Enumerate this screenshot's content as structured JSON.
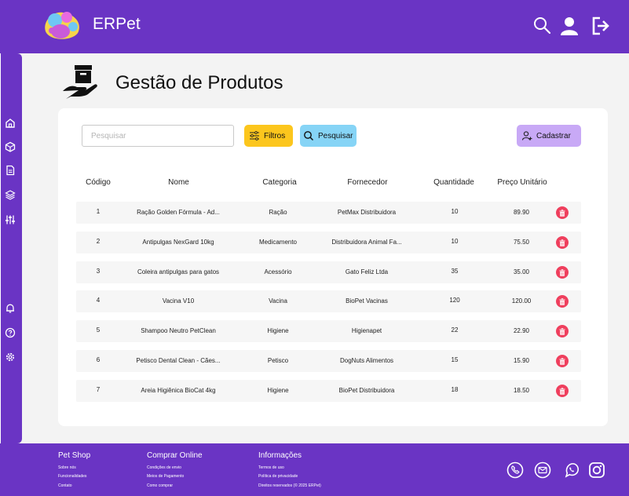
{
  "app": {
    "brand": "ERPet"
  },
  "page": {
    "title": "Gestão de Produtos"
  },
  "toolbar": {
    "search_placeholder": "Pesquisar",
    "filters_label": "Filtros",
    "search_label": "Pesquisar",
    "register_label": "Cadastrar"
  },
  "table": {
    "headers": {
      "code": "Código",
      "name": "Nome",
      "category": "Categoria",
      "supplier": "Fornecedor",
      "quantity": "Quantidade",
      "unit_price": "Preço Unitário"
    },
    "rows": [
      {
        "code": "1",
        "name": "Ração Golden Fórmula - Ad...",
        "category": "Ração",
        "supplier": "PetMax Distribuidora",
        "quantity": "10",
        "unit_price": "89.90"
      },
      {
        "code": "2",
        "name": "Antipulgas NexGard 10kg",
        "category": "Medicamento",
        "supplier": "Distribuidora Animal Fa...",
        "quantity": "10",
        "unit_price": "75.50"
      },
      {
        "code": "3",
        "name": "Coleira antipulgas para gatos",
        "category": "Acessório",
        "supplier": "Gato Feliz Ltda",
        "quantity": "35",
        "unit_price": "35.00"
      },
      {
        "code": "4",
        "name": "Vacina V10",
        "category": "Vacina",
        "supplier": "BioPet Vacinas",
        "quantity": "120",
        "unit_price": "120.00"
      },
      {
        "code": "5",
        "name": "Shampoo Neutro PetClean",
        "category": "Higiene",
        "supplier": "Higienapet",
        "quantity": "22",
        "unit_price": "22.90"
      },
      {
        "code": "6",
        "name": "Petisco Dental Clean - Cães...",
        "category": "Petisco",
        "supplier": "DogNuts Alimentos",
        "quantity": "15",
        "unit_price": "15.90"
      },
      {
        "code": "7",
        "name": "Areia Higiênica BioCat 4kg",
        "category": "Higiene",
        "supplier": "BioPet Distribuidora",
        "quantity": "18",
        "unit_price": "18.50"
      }
    ]
  },
  "footer": {
    "columns": [
      {
        "title": "Pet Shop",
        "links": [
          "Sobre nós",
          "Funcionalidades",
          "Contato"
        ]
      },
      {
        "title": "Comprar Online",
        "links": [
          "Condições de envio",
          "Meios de Pagamento",
          "Como comprar"
        ]
      },
      {
        "title": "Informações",
        "links": [
          "Termos de uso",
          "Política de privacidade",
          "Direitos reservados (© 2025 ERPet)"
        ]
      }
    ]
  },
  "icons": {
    "header": [
      "search-icon",
      "user-icon",
      "logout-icon"
    ],
    "sidebar": [
      "home-icon",
      "box-icon",
      "document-icon",
      "layers-icon",
      "sliders-icon",
      "bell-icon",
      "help-icon",
      "gear-icon"
    ],
    "social": [
      "phone-icon",
      "email-icon",
      "whatsapp-icon",
      "instagram-icon"
    ]
  },
  "colors": {
    "brand_purple": "#6a34c4",
    "filters_yellow": "#fcc61d",
    "search_blue": "#86d4f6",
    "register_lilac": "#c8a9f6",
    "delete_red": "#ef3f5d"
  }
}
